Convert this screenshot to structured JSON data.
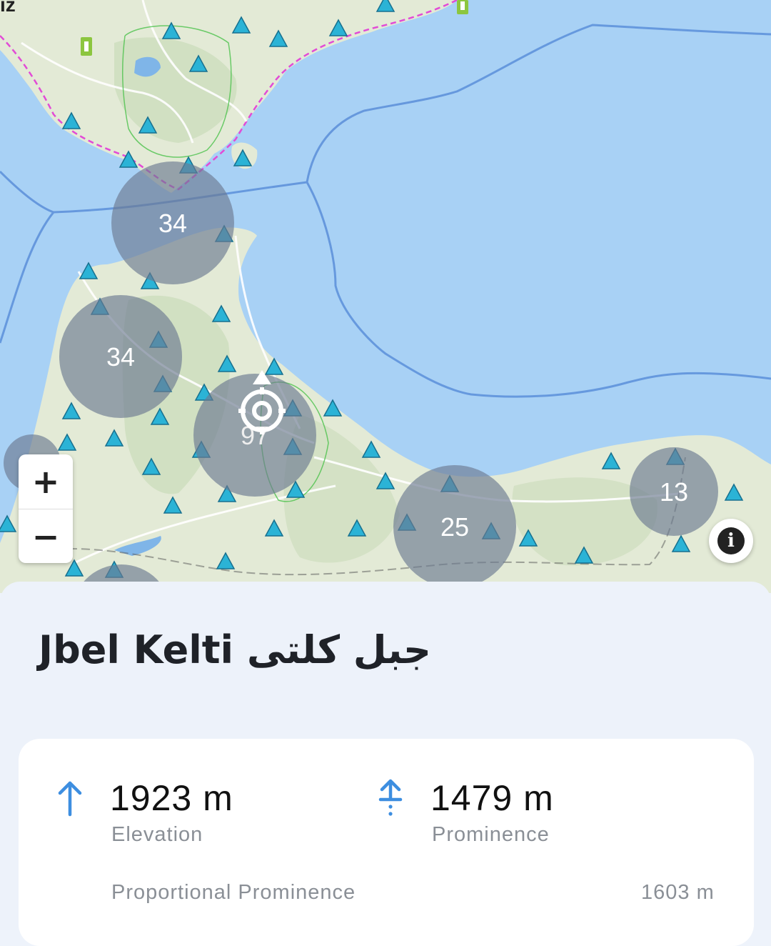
{
  "map": {
    "corner_label": "iz",
    "clusters": [
      {
        "id": "cluster-1",
        "count": "34"
      },
      {
        "id": "cluster-2",
        "count": "34"
      },
      {
        "id": "cluster-3",
        "count": "97"
      },
      {
        "id": "cluster-4",
        "count": "25"
      },
      {
        "id": "cluster-5",
        "count": "13"
      }
    ],
    "zoom_in_label": "+",
    "zoom_out_label": "−",
    "info_label": "i",
    "colors": {
      "sea": "#a8d1f5",
      "land": "#e3ead6",
      "cluster": "#6b7a91",
      "peak_marker": "#2bb3d6",
      "border": "#5b8fd9",
      "boundary_dashed": "#e24bd6"
    }
  },
  "peak": {
    "title": "Jbel Kelti جبل كلتى",
    "elevation_value": "1923 m",
    "elevation_label": "Elevation",
    "prominence_value": "1479 m",
    "prominence_label": "Prominence",
    "proportional_label": "Proportional Prominence",
    "proportional_value": "1603 m",
    "accent_color": "#3d8ee0"
  }
}
